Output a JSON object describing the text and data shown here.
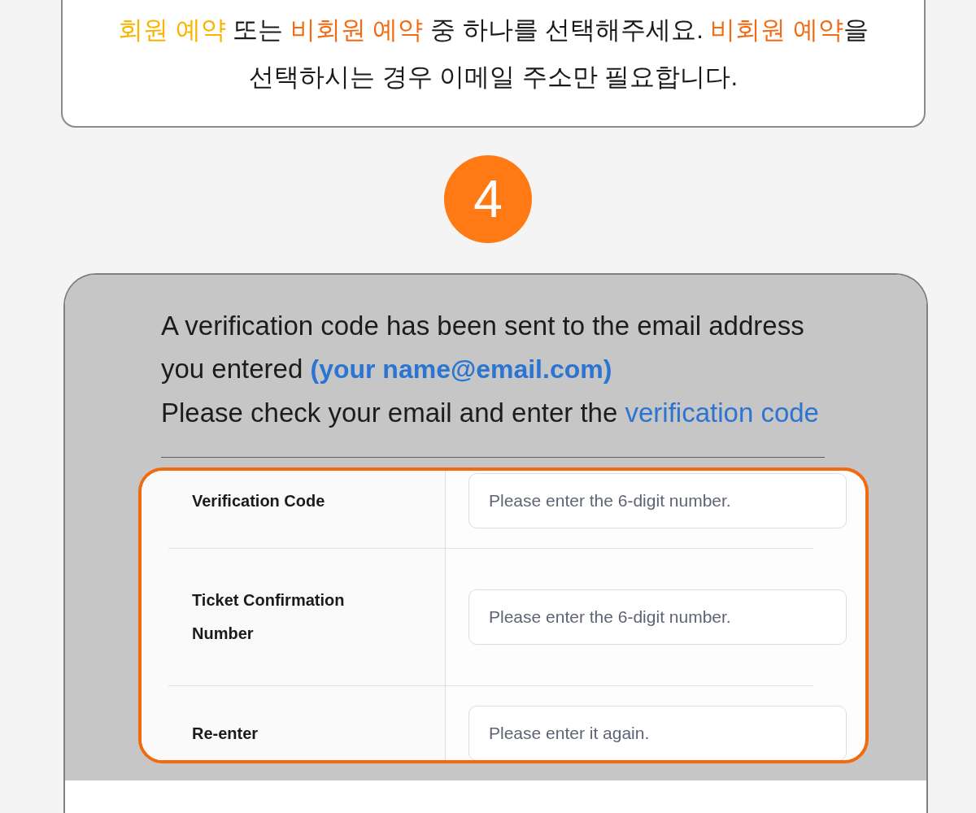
{
  "notice": {
    "lines": [
      [
        {
          "text": "회원 예약",
          "color": "#f7b500"
        },
        {
          "text": " 또는 ",
          "color": "#1a1a1a"
        },
        {
          "text": "비회원 예약",
          "color": "#f26b12"
        },
        {
          "text": " 중 하나를 선택해주세요. ",
          "color": "#1a1a1a"
        },
        {
          "text": "비회원 예약",
          "color": "#f26b12"
        },
        {
          "text": "을",
          "color": "#1a1a1a"
        }
      ],
      [
        {
          "text": "선택하시는 경우 이메일 주소만 필요합니다.",
          "color": "#1a1a1a"
        }
      ]
    ]
  },
  "step": {
    "number": "4"
  },
  "message": {
    "lines": [
      [
        {
          "text": "A verification code has been sent to the email address",
          "kind": "plain"
        }
      ],
      [
        {
          "text": "you entered ",
          "kind": "plain"
        },
        {
          "text": "(your name@email.com)",
          "kind": "email"
        }
      ],
      [
        {
          "text": "Please check your email and enter the ",
          "kind": "plain"
        },
        {
          "text": "verification code",
          "kind": "highlight"
        }
      ]
    ]
  },
  "form": {
    "rows": [
      {
        "label": "Verification Code",
        "placeholder": "Please enter the 6-digit number."
      },
      {
        "label": "Ticket Confirmation Number",
        "placeholder": "Please enter the 6-digit number."
      },
      {
        "label": "Re-enter",
        "placeholder": "Please enter it again."
      }
    ]
  }
}
